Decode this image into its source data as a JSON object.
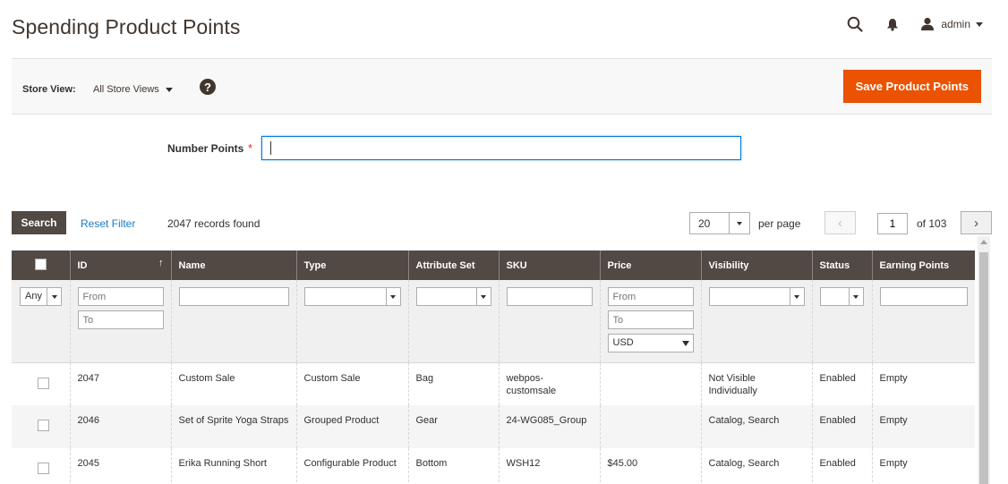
{
  "page": {
    "title": "Spending Product Points"
  },
  "header": {
    "user": "admin",
    "search_icon": "search-icon",
    "bell_icon": "bell-icon",
    "user_icon": "user-icon"
  },
  "actions": {
    "store_label": "Store View:",
    "store_value": "All Store Views",
    "help": "?",
    "save_label": "Save Product Points",
    "accent": "#eb5202"
  },
  "form": {
    "number_points_label": "Number Points",
    "required_mark": "*",
    "number_points_value": ""
  },
  "toolbar": {
    "search_label": "Search",
    "reset_label": "Reset Filter",
    "records": "2047 records found",
    "per_page_value": "20",
    "per_page_label": "per page",
    "page_value": "1",
    "of_pages": "of 103",
    "prev": "‹",
    "next": "›"
  },
  "grid": {
    "columns": [
      "",
      "ID",
      "Name",
      "Type",
      "Attribute Set",
      "SKU",
      "Price",
      "Visibility",
      "Status",
      "Earning Points"
    ],
    "sort_indicator": "↑",
    "filters": {
      "any": "Any",
      "id_from": "From",
      "id_to": "To",
      "price_from": "From",
      "price_to": "To",
      "currency": "USD"
    },
    "rows": [
      {
        "id": "2047",
        "name": "Custom Sale",
        "type": "Custom Sale",
        "attribute_set": "Bag",
        "sku": "webpos-customsale",
        "price": "",
        "visibility": "Not Visible Individually",
        "status": "Enabled",
        "earning_points": "Empty"
      },
      {
        "id": "2046",
        "name": "Set of Sprite Yoga Straps",
        "type": "Grouped Product",
        "attribute_set": "Gear",
        "sku": "24-WG085_Group",
        "price": "",
        "visibility": "Catalog, Search",
        "status": "Enabled",
        "earning_points": "Empty"
      },
      {
        "id": "2045",
        "name": "Erika Running Short",
        "type": "Configurable Product",
        "attribute_set": "Bottom",
        "sku": "WSH12",
        "price": "$45.00",
        "visibility": "Catalog, Search",
        "status": "Enabled",
        "earning_points": "Empty"
      }
    ]
  }
}
